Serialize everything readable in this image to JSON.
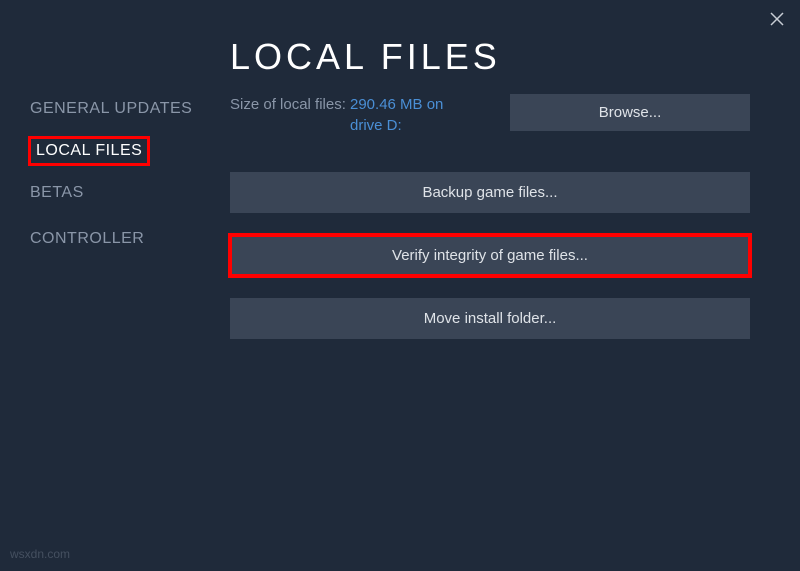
{
  "sidebar": {
    "items": [
      {
        "label": "GENERAL"
      },
      {
        "label": "UPDATES"
      },
      {
        "label": "LOCAL FILES"
      },
      {
        "label": "BETAS"
      },
      {
        "label": "CONTROLLER"
      }
    ]
  },
  "main": {
    "title": "LOCAL FILES",
    "size_label": "Size of local files:",
    "size_value": "290.46 MB on drive D:",
    "browse_label": "Browse...",
    "backup_label": "Backup game files...",
    "verify_label": "Verify integrity of game files...",
    "move_label": "Move install folder..."
  },
  "watermark": "wsxdn.com"
}
